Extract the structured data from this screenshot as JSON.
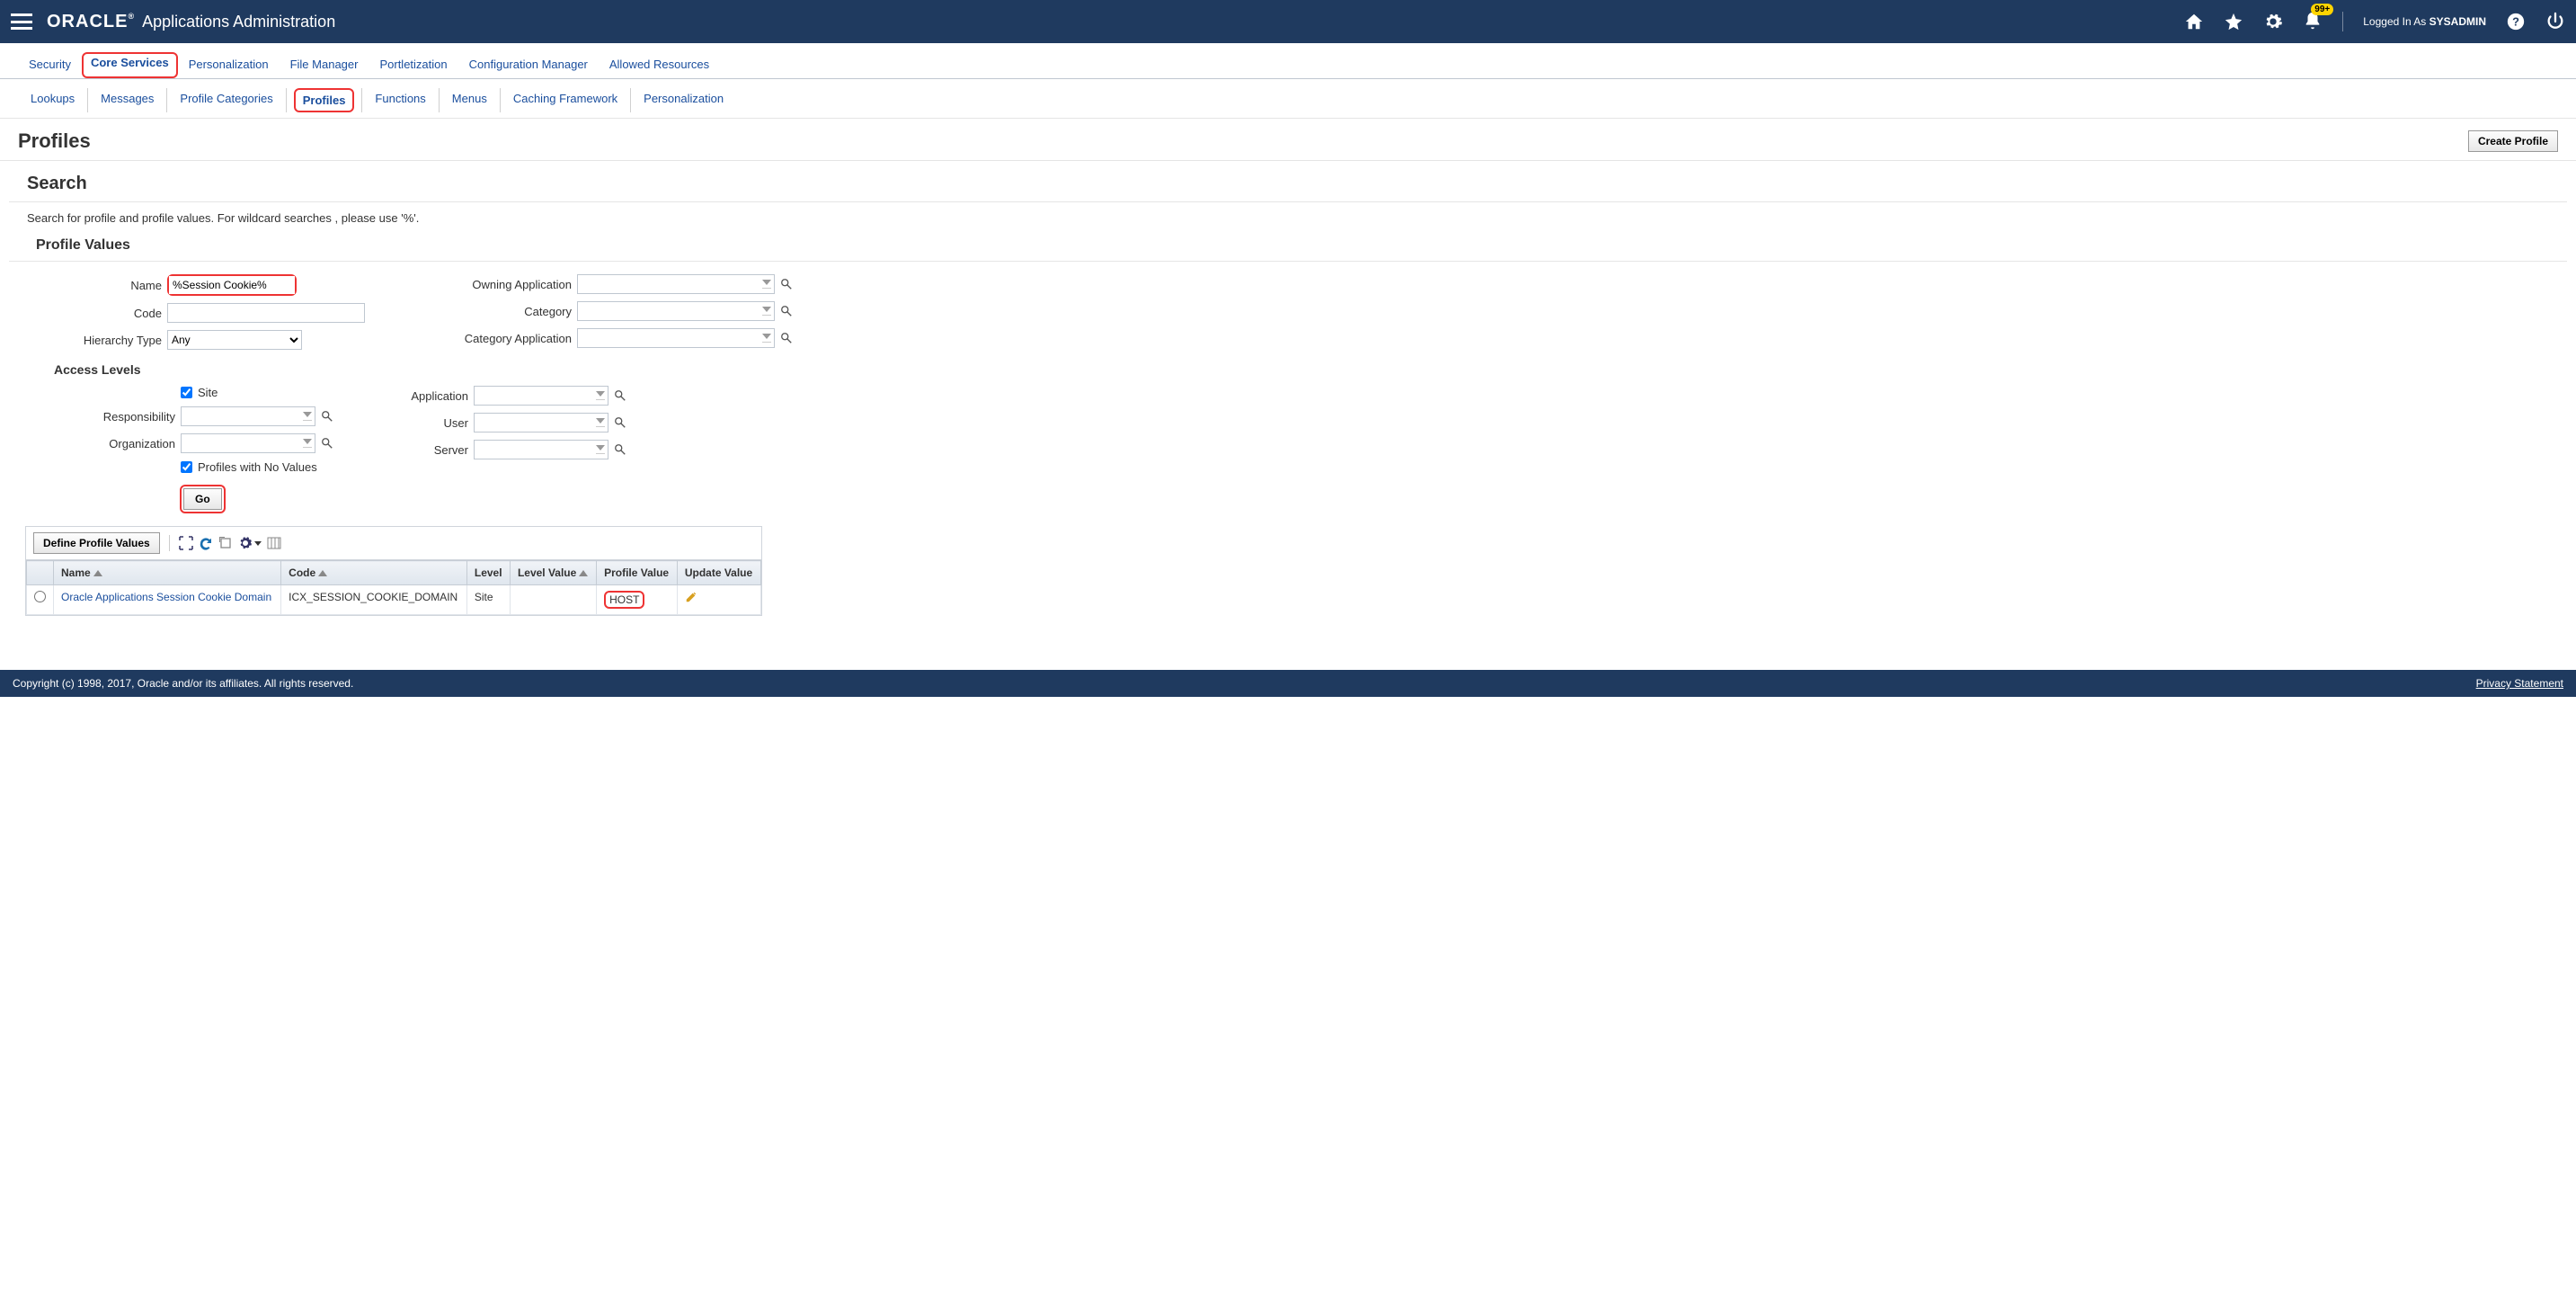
{
  "header": {
    "brand": "ORACLE",
    "app_name": "Applications Administration",
    "notification_badge": "99+",
    "logged_in_prefix": "Logged In As ",
    "logged_in_user": "SYSADMIN"
  },
  "tabs1": {
    "items": [
      "Security",
      "Core Services",
      "Personalization",
      "File Manager",
      "Portletization",
      "Configuration Manager",
      "Allowed Resources"
    ],
    "active": "Core Services"
  },
  "tabs2": {
    "items": [
      "Lookups",
      "Messages",
      "Profile Categories",
      "Profiles",
      "Functions",
      "Menus",
      "Caching Framework",
      "Personalization"
    ],
    "active": "Profiles"
  },
  "page": {
    "title": "Profiles",
    "create_label": "Create Profile"
  },
  "search": {
    "title": "Search",
    "help": "Search for profile and profile values. For wildcard searches , please use '%'.",
    "profile_values_title": "Profile Values",
    "labels": {
      "name": "Name",
      "code": "Code",
      "hierarchy": "Hierarchy Type",
      "owning_app": "Owning Application",
      "category": "Category",
      "category_app": "Category Application"
    },
    "values": {
      "name": "%Session Cookie%",
      "code": "",
      "hierarchy": "Any",
      "owning_app": "",
      "category": "",
      "category_app": ""
    },
    "hierarchy_options": [
      "Any"
    ]
  },
  "access_levels": {
    "title": "Access Levels",
    "site_check": true,
    "site_label": "Site",
    "responsibility_label": "Responsibility",
    "organization_label": "Organization",
    "application_label": "Application",
    "user_label": "User",
    "server_label": "Server",
    "no_values_check": true,
    "no_values_label": "Profiles with No Values",
    "go_label": "Go"
  },
  "results": {
    "define_label": "Define Profile Values",
    "columns": {
      "name": "Name",
      "code": "Code",
      "level": "Level",
      "level_value": "Level Value",
      "profile_value": "Profile Value",
      "update_value": "Update Value"
    },
    "rows": [
      {
        "name": "Oracle Applications Session Cookie Domain",
        "code": "ICX_SESSION_COOKIE_DOMAIN",
        "level": "Site",
        "level_value": "",
        "profile_value": "HOST"
      }
    ]
  },
  "footer": {
    "copyright": "Copyright (c) 1998, 2017, Oracle and/or its affiliates. All rights reserved.",
    "privacy": "Privacy Statement"
  }
}
